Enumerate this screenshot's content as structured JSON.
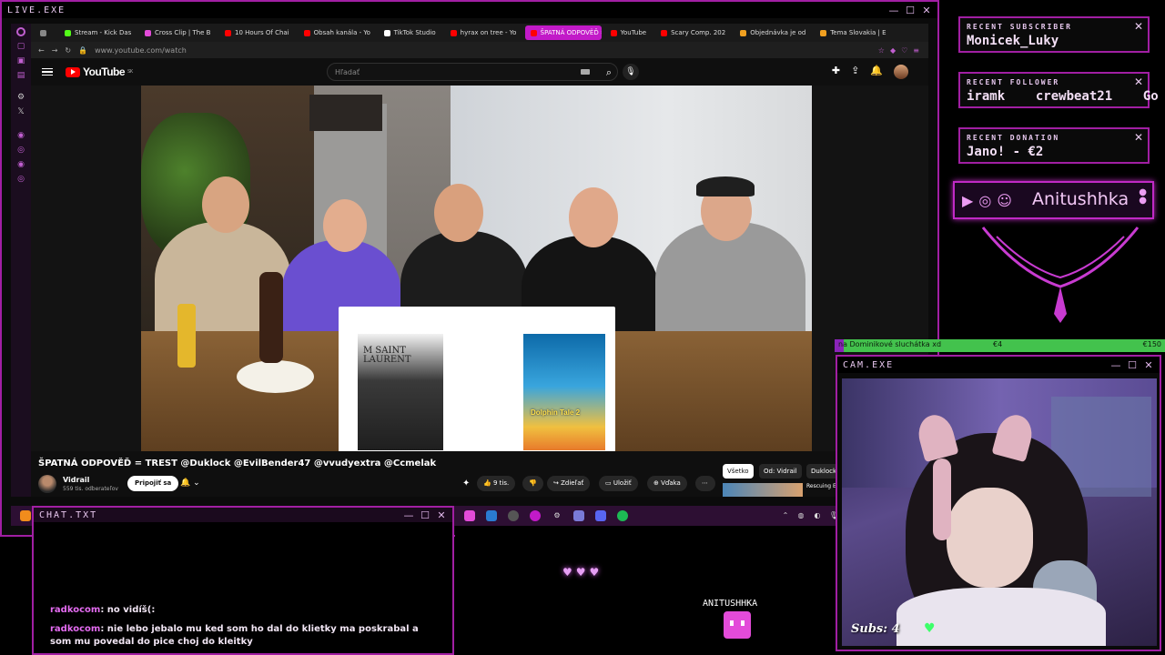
{
  "live_window": {
    "title": "LIVE.EXE",
    "controls": [
      "—",
      "☐",
      "✕"
    ]
  },
  "browser": {
    "tabs": [
      {
        "label": "",
        "color": "#888888",
        "active": false
      },
      {
        "label": "Stream - Kick Das",
        "color": "#53fc18",
        "active": false
      },
      {
        "label": "Cross Clip | The B",
        "color": "#e34bd9",
        "active": false
      },
      {
        "label": "10 Hours Of Chai",
        "color": "#ff0000",
        "active": false
      },
      {
        "label": "Obsah kanála - Yo",
        "color": "#ff0000",
        "active": false
      },
      {
        "label": "TikTok Studio",
        "color": "#ffffff",
        "active": false
      },
      {
        "label": "hyrax on tree - Yo",
        "color": "#ff0000",
        "active": false
      },
      {
        "label": "ŠPATNÁ ODPOVĚĎ = TRE",
        "color": "#ff0000",
        "active": true
      },
      {
        "label": "YouTube",
        "color": "#ff0000",
        "active": false
      },
      {
        "label": "Scary Comp. 202",
        "color": "#ff0000",
        "active": false
      },
      {
        "label": "Objednávka je od",
        "color": "#f0a020",
        "active": false
      },
      {
        "label": "Tema Slovakia | E",
        "color": "#f0a020",
        "active": false
      }
    ],
    "url": "www.youtube.com/watch"
  },
  "youtube": {
    "logo_text": "YouTube",
    "logo_region": "SK",
    "search_placeholder": "Hľadať",
    "video_title": "ŠPATNÁ ODPOVĚĎ = TREST @Duklock @EvilBender47 @vvudyextra @Ccmelak",
    "channel_name": "Vidrail",
    "channel_subs": "559 tis. odberateľov",
    "subscribe_label": "Pripojiť sa",
    "like_count": "9 tis.",
    "share_label": "Zdieľať",
    "save_label": "Uložiť",
    "thanks_label": "Vďaka",
    "chips": [
      "Všetko",
      "Od: Vidrail",
      "Duklock"
    ],
    "rec_title": "Rescuing Eagle",
    "poster1_text": "M SAINT LAURENT",
    "poster2_text": "Dolphin Tale 2"
  },
  "alerts": {
    "subscriber": {
      "label": "RECENT SUBSCRIBER",
      "value": "Monicek_Luky"
    },
    "follower": {
      "label": "RECENT FOLLOWER",
      "value": "iramk    crewbeat21    Go"
    },
    "donation": {
      "label": "RECENT DONATION",
      "value": "Jano! - €2"
    }
  },
  "social": {
    "name": "Anitushhka"
  },
  "goal": {
    "text": "na Dominikové sluchátka xd",
    "current": "€4",
    "target": "€150",
    "progress": 0.027
  },
  "cam": {
    "title": "CAM.EXE",
    "subs_text": "Subs: 4"
  },
  "chat": {
    "title": "CHAT.TXT",
    "messages": [
      {
        "user": "radkocom",
        "text": ": no vidíš(:"
      },
      {
        "user": "radkocom",
        "text": ": nie lebo jebalo mu ked som ho dal do klietky ma poskrabal a som mu povedal do pice choj do kleitky"
      }
    ]
  },
  "overlay": {
    "streamer_tag": "ANITUSHHKA",
    "hearts": "♥♥♥"
  },
  "colors": {
    "accent": "#a11fa3",
    "goal_green": "#43c24d",
    "youtube_red": "#ff0000"
  }
}
